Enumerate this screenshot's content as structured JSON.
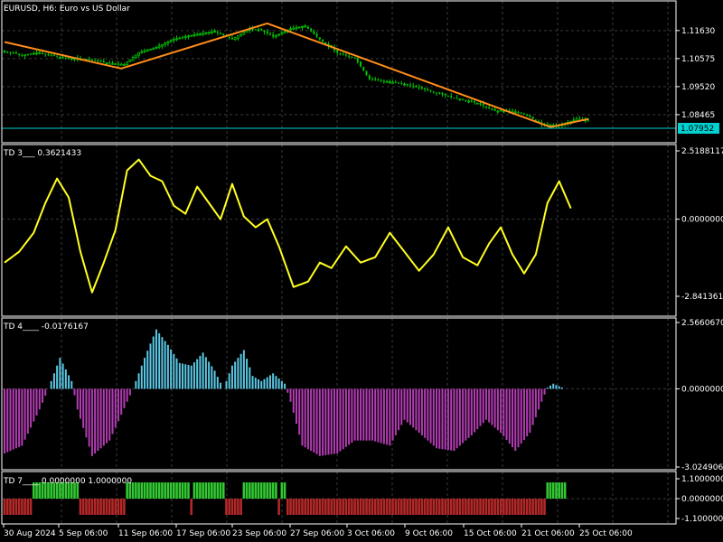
{
  "window": {
    "symbol_title": "EURUSD, H6:  Euro vs US Dollar"
  },
  "colors": {
    "background": "#000000",
    "axis": "#ffffff",
    "grid": "#3a3a3a",
    "bull": "#00c800",
    "bear": "#00c800",
    "zigzag": "#ff8c1a",
    "price_line": "#00d0d0",
    "td3": "#ffff20",
    "td4_pos": "#5ac8e6",
    "td4_neg": "#b43cb4",
    "td7_pos": "#32c832",
    "td7_neg": "#b42828"
  },
  "time_axis": {
    "labels": [
      "30 Aug 2024",
      "5 Sep 06:00",
      "11 Sep 06:00",
      "17 Sep 06:00",
      "23 Sep 06:00",
      "27 Sep 06:00",
      "3 Oct 06:00",
      "9 Oct 06:00",
      "15 Oct 06:00",
      "21 Oct 06:00",
      "25 Oct 06:00"
    ]
  },
  "chart_data": [
    {
      "type": "candlestick",
      "title": "EURUSD, H6:  Euro vs US Dollar",
      "ylim": [
        1.0768,
        1.121
      ],
      "y_ticks": [
        "1.11630",
        "1.10575",
        "1.09520",
        "1.08465"
      ],
      "current_price": "1.07952",
      "zigzag": [
        {
          "i": 0,
          "price": 1.112
        },
        {
          "i": 40,
          "price": 1.102
        },
        {
          "i": 90,
          "price": 1.119
        },
        {
          "i": 187,
          "price": 1.08
        },
        {
          "i": 200,
          "price": 1.083
        }
      ],
      "close_path": [
        {
          "i": 0,
          "v": 1.1085
        },
        {
          "i": 6,
          "v": 1.107
        },
        {
          "i": 12,
          "v": 1.108
        },
        {
          "i": 20,
          "v": 1.106
        },
        {
          "i": 28,
          "v": 1.1055
        },
        {
          "i": 36,
          "v": 1.104
        },
        {
          "i": 41,
          "v": 1.1035
        },
        {
          "i": 46,
          "v": 1.108
        },
        {
          "i": 52,
          "v": 1.11
        },
        {
          "i": 58,
          "v": 1.113
        },
        {
          "i": 64,
          "v": 1.1145
        },
        {
          "i": 72,
          "v": 1.116
        },
        {
          "i": 78,
          "v": 1.113
        },
        {
          "i": 84,
          "v": 1.117
        },
        {
          "i": 88,
          "v": 1.1165
        },
        {
          "i": 92,
          "v": 1.114
        },
        {
          "i": 98,
          "v": 1.117
        },
        {
          "i": 103,
          "v": 1.118
        },
        {
          "i": 108,
          "v": 1.113
        },
        {
          "i": 114,
          "v": 1.108
        },
        {
          "i": 120,
          "v": 1.106
        },
        {
          "i": 125,
          "v": 1.098
        },
        {
          "i": 132,
          "v": 1.097
        },
        {
          "i": 138,
          "v": 1.096
        },
        {
          "i": 146,
          "v": 1.0935
        },
        {
          "i": 154,
          "v": 1.091
        },
        {
          "i": 162,
          "v": 1.089
        },
        {
          "i": 168,
          "v": 1.086
        },
        {
          "i": 174,
          "v": 1.086
        },
        {
          "i": 178,
          "v": 1.085
        },
        {
          "i": 184,
          "v": 1.081
        },
        {
          "i": 190,
          "v": 1.0805
        },
        {
          "i": 196,
          "v": 1.083
        },
        {
          "i": 200,
          "v": 1.0825
        }
      ],
      "n_bars": 201
    },
    {
      "type": "line",
      "title": "TD 3___ 0.3621433",
      "ylim": [
        -2.841361,
        2.5188117
      ],
      "y_ticks": [
        "2.5188117",
        "0.0000000",
        "-2.8413610"
      ],
      "points": [
        {
          "i": 0,
          "v": -1.6
        },
        {
          "i": 5,
          "v": -1.2
        },
        {
          "i": 10,
          "v": -0.5
        },
        {
          "i": 14,
          "v": 0.6
        },
        {
          "i": 18,
          "v": 1.5
        },
        {
          "i": 22,
          "v": 0.8
        },
        {
          "i": 26,
          "v": -1.2
        },
        {
          "i": 30,
          "v": -2.7
        },
        {
          "i": 34,
          "v": -1.6
        },
        {
          "i": 38,
          "v": -0.4
        },
        {
          "i": 42,
          "v": 1.8
        },
        {
          "i": 46,
          "v": 2.2
        },
        {
          "i": 50,
          "v": 1.6
        },
        {
          "i": 54,
          "v": 1.4
        },
        {
          "i": 58,
          "v": 0.5
        },
        {
          "i": 62,
          "v": 0.2
        },
        {
          "i": 66,
          "v": 1.2
        },
        {
          "i": 70,
          "v": 0.6
        },
        {
          "i": 74,
          "v": 0.0
        },
        {
          "i": 78,
          "v": 1.3
        },
        {
          "i": 82,
          "v": 0.1
        },
        {
          "i": 86,
          "v": -0.3
        },
        {
          "i": 90,
          "v": 0.0
        },
        {
          "i": 94,
          "v": -1.0
        },
        {
          "i": 99,
          "v": -2.5
        },
        {
          "i": 104,
          "v": -2.3
        },
        {
          "i": 108,
          "v": -1.6
        },
        {
          "i": 112,
          "v": -1.8
        },
        {
          "i": 117,
          "v": -1.0
        },
        {
          "i": 122,
          "v": -1.6
        },
        {
          "i": 127,
          "v": -1.4
        },
        {
          "i": 132,
          "v": -0.5
        },
        {
          "i": 137,
          "v": -1.2
        },
        {
          "i": 142,
          "v": -1.9
        },
        {
          "i": 147,
          "v": -1.3
        },
        {
          "i": 152,
          "v": -0.3
        },
        {
          "i": 157,
          "v": -1.4
        },
        {
          "i": 162,
          "v": -1.7
        },
        {
          "i": 166,
          "v": -0.9
        },
        {
          "i": 170,
          "v": -0.3
        },
        {
          "i": 174,
          "v": -1.3
        },
        {
          "i": 178,
          "v": -2.0
        },
        {
          "i": 182,
          "v": -1.3
        },
        {
          "i": 186,
          "v": 0.6
        },
        {
          "i": 190,
          "v": 1.4
        },
        {
          "i": 194,
          "v": 0.4
        }
      ]
    },
    {
      "type": "histogram",
      "title": "TD 4____ -0.0176167",
      "ylim": [
        -3.0249066,
        2.566067
      ],
      "y_ticks": [
        "2.5660670",
        "0.0000000",
        "-3.0249066"
      ],
      "points": [
        {
          "i": 0,
          "v": -2.5
        },
        {
          "i": 6,
          "v": -2.2
        },
        {
          "i": 12,
          "v": -0.8
        },
        {
          "i": 15,
          "v": 0.0
        },
        {
          "i": 19,
          "v": 1.2
        },
        {
          "i": 23,
          "v": 0.3
        },
        {
          "i": 25,
          "v": -0.8
        },
        {
          "i": 30,
          "v": -2.6
        },
        {
          "i": 36,
          "v": -2.0
        },
        {
          "i": 42,
          "v": -0.5
        },
        {
          "i": 44,
          "v": 0.0
        },
        {
          "i": 48,
          "v": 1.2
        },
        {
          "i": 52,
          "v": 2.3
        },
        {
          "i": 56,
          "v": 1.7
        },
        {
          "i": 60,
          "v": 1.0
        },
        {
          "i": 64,
          "v": 0.9
        },
        {
          "i": 68,
          "v": 1.4
        },
        {
          "i": 72,
          "v": 0.7
        },
        {
          "i": 75,
          "v": 0.0
        },
        {
          "i": 78,
          "v": 0.9
        },
        {
          "i": 82,
          "v": 1.5
        },
        {
          "i": 85,
          "v": 0.5
        },
        {
          "i": 88,
          "v": 0.3
        },
        {
          "i": 92,
          "v": 0.6
        },
        {
          "i": 96,
          "v": 0.2
        },
        {
          "i": 98,
          "v": -0.5
        },
        {
          "i": 102,
          "v": -2.2
        },
        {
          "i": 108,
          "v": -2.6
        },
        {
          "i": 114,
          "v": -2.5
        },
        {
          "i": 120,
          "v": -2.0
        },
        {
          "i": 126,
          "v": -2.0
        },
        {
          "i": 132,
          "v": -2.2
        },
        {
          "i": 137,
          "v": -1.2
        },
        {
          "i": 142,
          "v": -1.7
        },
        {
          "i": 148,
          "v": -2.3
        },
        {
          "i": 154,
          "v": -2.4
        },
        {
          "i": 160,
          "v": -1.8
        },
        {
          "i": 165,
          "v": -1.2
        },
        {
          "i": 170,
          "v": -1.7
        },
        {
          "i": 175,
          "v": -2.4
        },
        {
          "i": 180,
          "v": -1.7
        },
        {
          "i": 184,
          "v": -0.5
        },
        {
          "i": 186,
          "v": 0.05
        },
        {
          "i": 188,
          "v": 0.2
        },
        {
          "i": 190,
          "v": 0.1
        },
        {
          "i": 192,
          "v": 0.0
        }
      ]
    },
    {
      "type": "histogram",
      "title": "TD 7____ 0.0000000 1.0000000",
      "ylim": [
        -1.1,
        1.1
      ],
      "y_ticks": [
        "1.1000000",
        "0.0000000",
        "-1.1000000"
      ],
      "segments": [
        {
          "from": 0,
          "to": 9,
          "v": -1
        },
        {
          "from": 10,
          "to": 25,
          "v": 1
        },
        {
          "from": 26,
          "to": 41,
          "v": -1
        },
        {
          "from": 42,
          "to": 63,
          "v": 1
        },
        {
          "from": 64,
          "to": 64,
          "v": -1
        },
        {
          "from": 65,
          "to": 75,
          "v": 1
        },
        {
          "from": 76,
          "to": 81,
          "v": -1
        },
        {
          "from": 82,
          "to": 93,
          "v": 1
        },
        {
          "from": 94,
          "to": 94,
          "v": -1
        },
        {
          "from": 95,
          "to": 96,
          "v": 1
        },
        {
          "from": 97,
          "to": 185,
          "v": -1
        },
        {
          "from": 186,
          "to": 192,
          "v": 1
        }
      ]
    }
  ]
}
